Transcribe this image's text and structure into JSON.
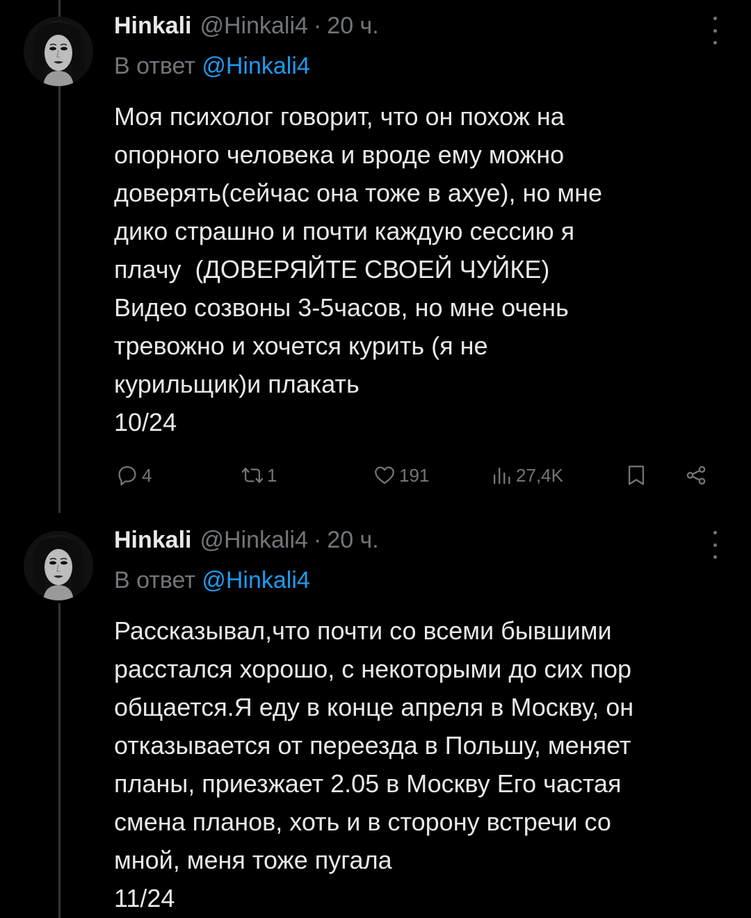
{
  "tweets": [
    {
      "author": {
        "name": "Hinkali",
        "handle": "@Hinkali4"
      },
      "separator": "·",
      "time": "20 ч.",
      "reply_prefix": "В ответ ",
      "reply_to": "@Hinkali4",
      "text": "Моя психолог говорит, что он похож на\nопорного человека и вроде ему можно\nдоверять(сейчас она тоже в ахуе), но мне\nдико страшно и почти каждую сессию я\nплачу  (ДОВЕРЯЙТЕ СВОЕЙ ЧУЙКЕ)\nВидео созвоны 3-5часов, но мне очень\nтревожно и хочется курить (я не\nкурильщик)и плакать\n10/24",
      "stats": {
        "replies": "4",
        "reposts": "1",
        "likes": "191",
        "views": "27,4K"
      }
    },
    {
      "author": {
        "name": "Hinkali",
        "handle": "@Hinkali4"
      },
      "separator": "·",
      "time": "20 ч.",
      "reply_prefix": "В ответ ",
      "reply_to": "@Hinkali4",
      "text": "Рассказывал,что почти со всеми бывшими\nрасстался хорошо, с некоторыми до сих пор\nобщается.Я еду в конце апреля в Москву, он\nотказывается от переезда в Польшу, меняет\nпланы, приезжает 2.05 в Москву Его частая\nсмена планов, хоть и в сторону встречи со\nмной, меня тоже пугала\n11/24"
    }
  ],
  "icons": {
    "reply": "reply-icon",
    "repost": "repost-icon",
    "like": "heart-icon",
    "views": "views-icon",
    "bookmark": "bookmark-icon",
    "share": "share-icon",
    "more": "more-options-icon"
  },
  "colors": {
    "background": "#000000",
    "text": "#e7e9ea",
    "secondary": "#71767b",
    "mention": "#1d9bf0"
  }
}
